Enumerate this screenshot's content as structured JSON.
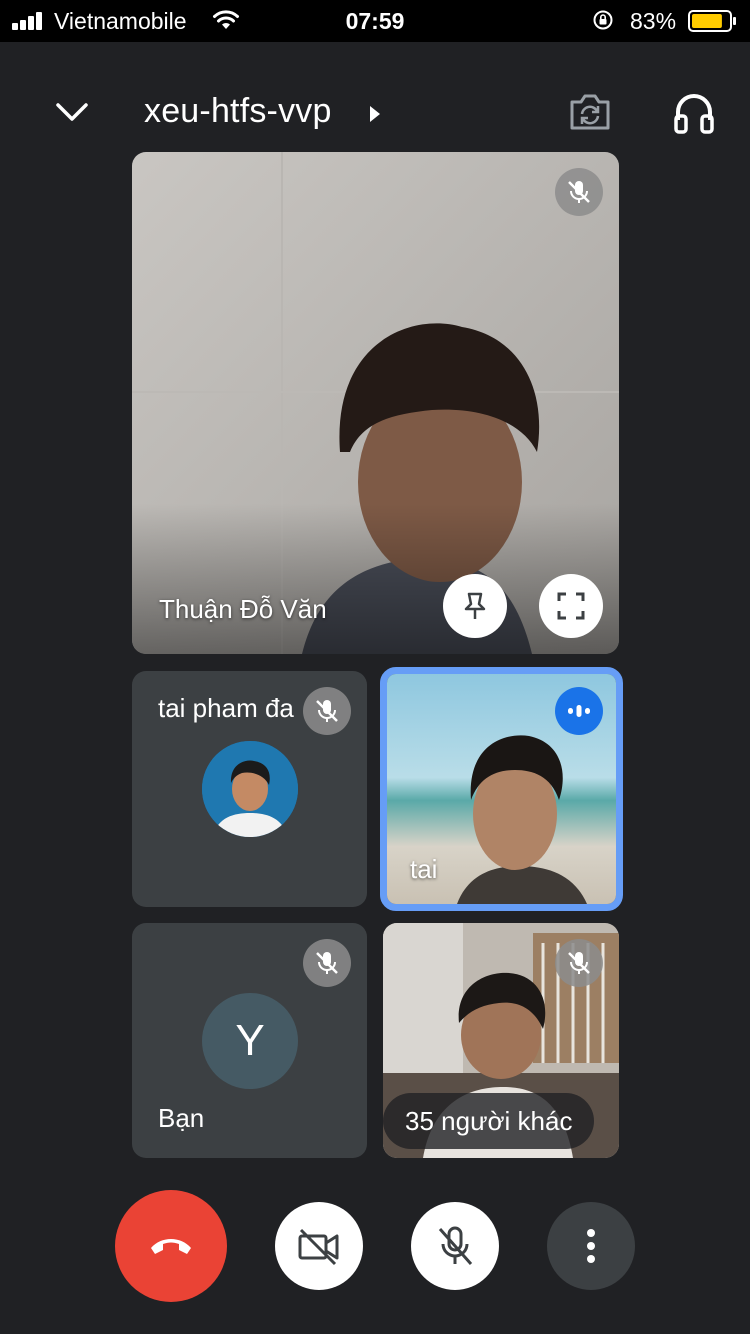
{
  "status_bar": {
    "carrier": "Vietnamobile",
    "time": "07:59",
    "battery_percent": "83%",
    "battery_level": 0.83,
    "battery_color": "#ffcc00",
    "icons": [
      "signal-icon",
      "wifi-icon",
      "orientation-lock-icon",
      "battery-icon"
    ]
  },
  "header": {
    "meeting_code": "xeu-htfs-vvp",
    "icons": [
      "chevron-down-icon",
      "caret-right-icon",
      "switch-camera-icon",
      "headphones-icon"
    ]
  },
  "participants": {
    "main": {
      "name": "Thuận Đỗ Văn",
      "muted": true
    },
    "tile_a": {
      "name": "tai pham đa",
      "muted": true
    },
    "tile_b": {
      "name": "tai",
      "speaking": true,
      "highlight_color": "#669df6"
    },
    "tile_c": {
      "name": "Bạn",
      "avatar_letter": "Y",
      "muted": true
    },
    "tile_d": {
      "label": "35 người khác",
      "muted": true
    }
  },
  "controls": {
    "end_call_color": "#ea4335",
    "items": [
      "end-call-button",
      "camera-off-button",
      "mic-off-button",
      "more-options-button"
    ]
  }
}
